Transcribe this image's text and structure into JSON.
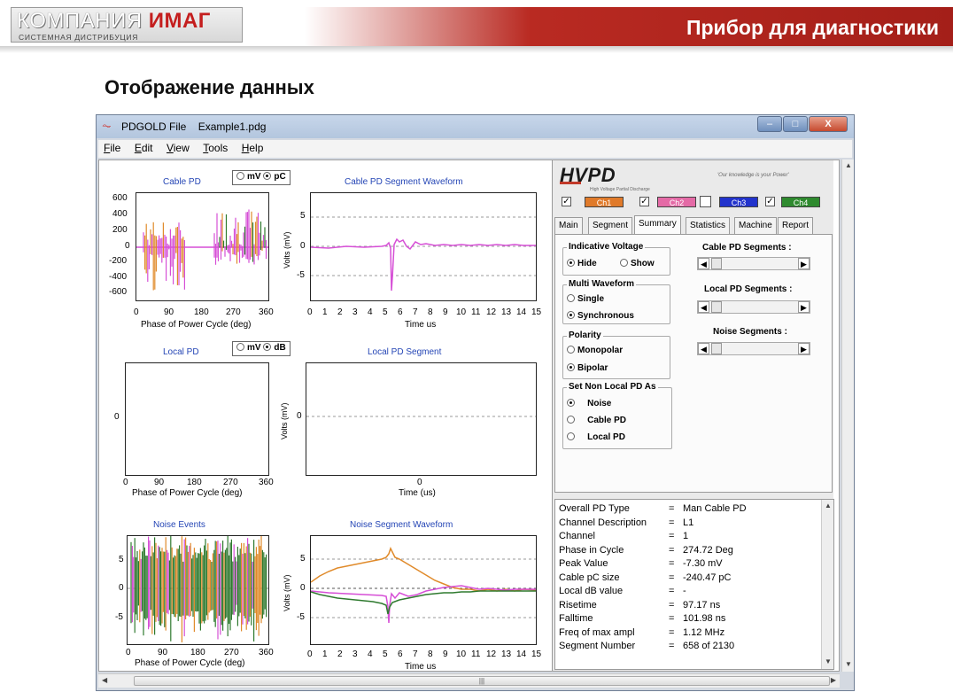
{
  "slide": {
    "logo_main": "КОМПАНИЯ",
    "logo_accent": "ИМАГ",
    "logo_sub": "СИСТЕМНАЯ ДИСТРИБУЦИЯ",
    "header_title": "Прибор для диагностики",
    "title": "Отображение данных"
  },
  "window": {
    "app_name": "PDGOLD File",
    "file_name": "Example1.pdg",
    "minimize": "–",
    "maximize": "□",
    "close": "X"
  },
  "menu": [
    {
      "key": "F",
      "rest": "ile"
    },
    {
      "key": "E",
      "rest": "dit"
    },
    {
      "key": "V",
      "rest": "iew"
    },
    {
      "key": "T",
      "rest": "ools"
    },
    {
      "key": "H",
      "rest": "elp"
    }
  ],
  "plots": {
    "cable_pd": {
      "title": "Cable PD",
      "unit_opts": [
        "mV",
        "pC"
      ],
      "unit_selected": "pC",
      "yticks": [
        "600",
        "400",
        "200",
        "0",
        "-200",
        "-400",
        "-600"
      ],
      "xticks": [
        "0",
        "90",
        "180",
        "270",
        "360"
      ],
      "xlabel": "Phase of Power Cycle (deg)"
    },
    "cable_segment": {
      "title": "Cable PD Segment Waveform",
      "yticks": [
        "5",
        "0",
        "-5"
      ],
      "ylabel": "Volts (mV)",
      "xticks": [
        "0",
        "1",
        "2",
        "3",
        "4",
        "5",
        "6",
        "7",
        "8",
        "9",
        "10",
        "11",
        "12",
        "13",
        "14",
        "15"
      ],
      "xlabel": "Time us"
    },
    "local_pd": {
      "title": "Local PD",
      "unit_opts": [
        "mV",
        "dB"
      ],
      "unit_selected": "dB",
      "yticks": [
        "0"
      ],
      "xticks": [
        "0",
        "90",
        "180",
        "270",
        "360"
      ],
      "xlabel": "Phase of Power Cycle (deg)"
    },
    "local_segment": {
      "title": "Local PD Segment",
      "yticks": [
        "0"
      ],
      "ylabel": "Volts (mV)",
      "xticks": [
        "0"
      ],
      "xlabel": "Time (us)"
    },
    "noise_events": {
      "title": "Noise Events",
      "yticks": [
        "5",
        "0",
        "-5"
      ],
      "xticks": [
        "0",
        "90",
        "180",
        "270",
        "360"
      ],
      "xlabel": "Phase of Power Cycle (deg)"
    },
    "noise_segment": {
      "title": "Noise Segment Waveform",
      "yticks": [
        "5",
        "0",
        "-5"
      ],
      "ylabel": "Volts (mV)",
      "xticks": [
        "0",
        "1",
        "2",
        "3",
        "4",
        "5",
        "6",
        "7",
        "8",
        "9",
        "10",
        "11",
        "12",
        "13",
        "14",
        "15"
      ],
      "xlabel": "Time us"
    }
  },
  "panel": {
    "logo": "HVPD",
    "logo_sub": "High Voltage Partial Discharge",
    "slogan": "'Our knowledge is your Power'",
    "channels": [
      {
        "label": "Ch1",
        "checked": true,
        "color": "#e07a2a"
      },
      {
        "label": "Ch2",
        "checked": true,
        "color": "#e46aa6"
      },
      {
        "label": "Ch3",
        "checked": false,
        "color": "#2233cc"
      },
      {
        "label": "Ch4",
        "checked": true,
        "color": "#2e8a2e"
      }
    ],
    "tabs": [
      "Main",
      "Segment",
      "Summary",
      "Statistics",
      "Machine",
      "Report"
    ],
    "active_tab": "Summary",
    "indicative_voltage": {
      "title": "Indicative Voltage",
      "options": [
        "Hide",
        "Show"
      ],
      "selected": "Hide"
    },
    "multi_waveform": {
      "title": "Multi Waveform",
      "options": [
        "Single",
        "Synchronous"
      ],
      "selected": "Synchronous"
    },
    "polarity": {
      "title": "Polarity",
      "options": [
        "Monopolar",
        "Bipolar"
      ],
      "selected": "Bipolar"
    },
    "non_local": {
      "title": "Set Non Local PD As",
      "options": [
        "Noise",
        "Cable PD",
        "Local PD"
      ],
      "selected": "Noise"
    },
    "segments": [
      "Cable PD Segments :",
      "Local PD Segments :",
      "Noise Segments :"
    ],
    "info": [
      {
        "k": "Overall PD Type",
        "v": "Man Cable PD"
      },
      {
        "k": "Channel Description",
        "v": "L1"
      },
      {
        "k": "Channel",
        "v": "1"
      },
      {
        "k": "Phase in Cycle",
        "v": "274.72 Deg"
      },
      {
        "k": "Peak Value",
        "v": "-7.30 mV"
      },
      {
        "k": "Cable pC size",
        "v": "-240.47 pC"
      },
      {
        "k": "Local dB value",
        "v": "-"
      },
      {
        "k": "Risetime",
        "v": "97.17 ns"
      },
      {
        "k": "Falltime",
        "v": "101.98 ns"
      },
      {
        "k": "Freq of max ampl",
        "v": "1.12 MHz"
      },
      {
        "k": "Segment Number",
        "v": "658 of 2130"
      }
    ]
  },
  "colors": {
    "orange": "#e08a2a",
    "magenta": "#d64fd6",
    "green": "#2f7a2f",
    "title_blue": "#2445b5",
    "brand_red": "#b92a22"
  }
}
